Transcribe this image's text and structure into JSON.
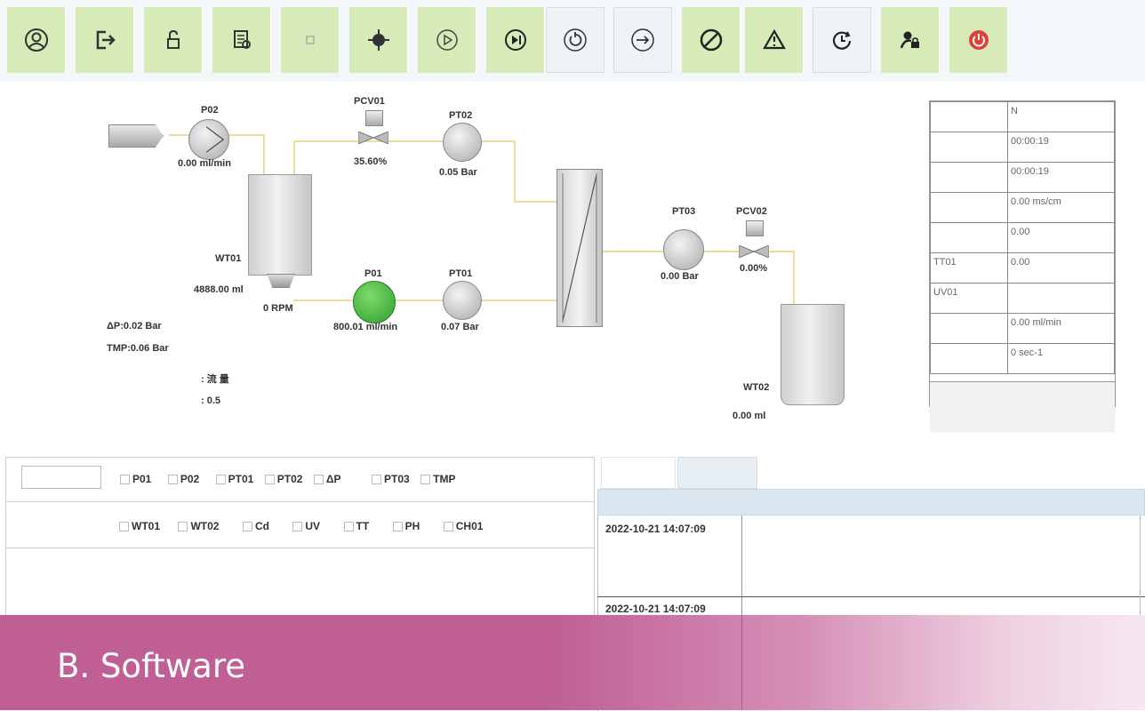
{
  "toolbar": {
    "buttons": [
      {
        "icon": "user-icon"
      },
      {
        "icon": "logout-icon"
      },
      {
        "icon": "unlock-icon"
      },
      {
        "icon": "report-icon"
      },
      {
        "icon": "disabled-icon"
      },
      {
        "icon": "target-icon"
      },
      {
        "icon": "play-icon"
      },
      {
        "icon": "step-icon"
      },
      {
        "icon": "reset-icon"
      },
      {
        "icon": "next-icon"
      },
      {
        "icon": "stop-icon"
      },
      {
        "icon": "warning-icon"
      },
      {
        "icon": "timer-icon"
      },
      {
        "icon": "user-lock-icon"
      },
      {
        "icon": "power-icon"
      }
    ]
  },
  "process": {
    "p02": {
      "name": "P02",
      "value": "0.00 ml/min"
    },
    "pcv01": {
      "name": "PCV01",
      "value": "35.60%"
    },
    "pt02": {
      "name": "PT02",
      "value": "0.05 Bar"
    },
    "wt01": {
      "name": "WT01",
      "value": "4888.00 ml",
      "rpm": "0 RPM"
    },
    "p01": {
      "name": "P01",
      "value": "800.01 ml/min"
    },
    "pt01": {
      "name": "PT01",
      "value": "0.07 Bar"
    },
    "pt03": {
      "name": "PT03",
      "value": "0.00 Bar"
    },
    "pcv02": {
      "name": "PCV02",
      "value": "0.00%"
    },
    "wt02": {
      "name": "WT02",
      "value": "0.00 ml"
    },
    "dp": "ΔP:0.02 Bar",
    "tmp": "TMP:0.06 Bar",
    "misc1": ": 流 量",
    "misc2": ": 0.5"
  },
  "info_table": [
    [
      "",
      "N"
    ],
    [
      "",
      "00:00:19"
    ],
    [
      "",
      "00:00:19"
    ],
    [
      "",
      "0.00 ms/cm"
    ],
    [
      "",
      "0.00"
    ],
    [
      "TT01",
      "0.00"
    ],
    [
      "UV01",
      ""
    ],
    [
      "",
      "0.00 ml/min"
    ],
    [
      "",
      "0 sec-1"
    ]
  ],
  "checkboxes_row1": [
    "P01",
    "P02",
    "PT01",
    "PT02",
    "ΔP",
    "PT03",
    "TMP"
  ],
  "checkboxes_row2": [
    "WT01",
    "WT02",
    "Cd",
    "UV",
    "TT",
    "PH",
    "CH01"
  ],
  "log": {
    "rows": [
      {
        "time": "2022-10-21 14:07:09",
        "msg": ""
      },
      {
        "time": "2022-10-21 14:07:09",
        "msg": ""
      }
    ]
  },
  "banner": {
    "title": "B. Software"
  },
  "colors": {
    "toolbar_button": "#d6ebb8",
    "pump_active": "#3cae3c",
    "banner": "#bd5a92",
    "pipe": "#e8dc9e"
  }
}
